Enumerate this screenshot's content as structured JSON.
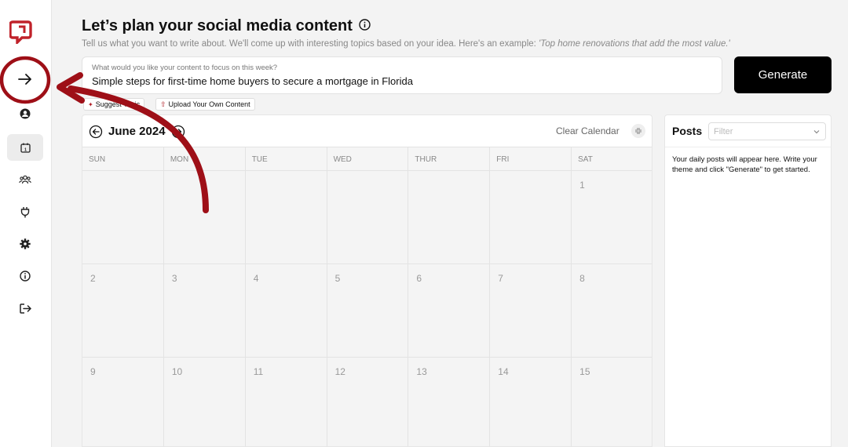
{
  "sidebar": {
    "logo_icon": "brand-logo-icon",
    "items": [
      {
        "icon": "arrow-right-icon",
        "name": "expand"
      },
      {
        "icon": "user-circle-icon",
        "name": "profile"
      },
      {
        "icon": "calendar-icon",
        "name": "calendar"
      },
      {
        "icon": "users-icon",
        "name": "team"
      },
      {
        "icon": "plug-icon",
        "name": "integrations"
      },
      {
        "icon": "gear-icon",
        "name": "settings"
      },
      {
        "icon": "info-icon",
        "name": "info"
      },
      {
        "icon": "logout-icon",
        "name": "logout"
      }
    ]
  },
  "header": {
    "title": "Let’s plan your social media content",
    "subtitle": "Tell us what you want to write about. We'll come up with interesting topics based on your idea. Here's an example: ",
    "subtitle_example": "'Top home renovations that add the most value.'"
  },
  "prompt": {
    "label": "What would you like your content to focus on this week?",
    "value": "Simple steps for first-time home buyers to secure a mortgage in Florida"
  },
  "generate_label": "Generate",
  "chips": {
    "suggest": "Suggest Topic",
    "upload": "Upload Your Own Content"
  },
  "calendar": {
    "month": "June 2024",
    "clear_label": "Clear Calendar",
    "days_of_week": [
      "SUN",
      "MON",
      "TUE",
      "WED",
      "THUR",
      "FRI",
      "SAT"
    ],
    "weeks": [
      [
        "",
        "",
        "",
        "",
        "",
        "",
        "1"
      ],
      [
        "2",
        "3",
        "4",
        "5",
        "6",
        "7",
        "8"
      ],
      [
        "9",
        "10",
        "11",
        "12",
        "13",
        "14",
        "15"
      ]
    ]
  },
  "posts": {
    "title": "Posts",
    "filter_placeholder": "Filter",
    "empty_message": "Your daily posts will appear here. Write your theme and click \"Generate\" to get started."
  },
  "colors": {
    "brand_red": "#b01c24",
    "annotation_red": "#9e0f17",
    "button_black": "#000000"
  }
}
